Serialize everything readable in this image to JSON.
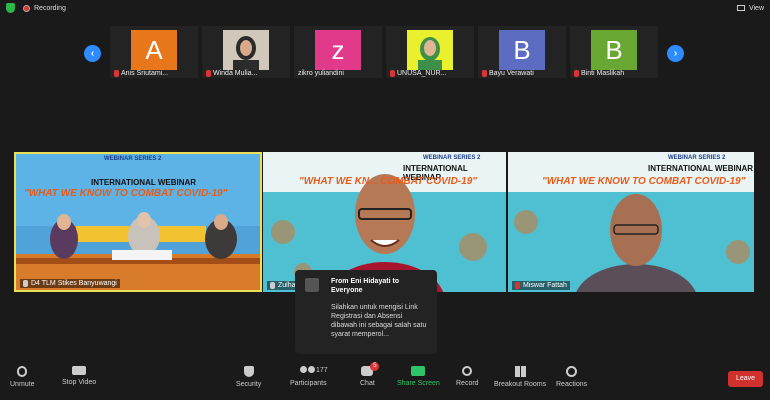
{
  "top": {
    "recording": "Recording",
    "view": "View"
  },
  "strip": {
    "participants": [
      {
        "initial": "A",
        "name": "Anis Sriutami...",
        "color": "#e8771c"
      },
      {
        "initial": "",
        "name": "Winda Mulia...",
        "color": "#c9c0b0"
      },
      {
        "initial": "z",
        "name": "zikro yuliandini",
        "color": "#e13a8b"
      },
      {
        "initial": "",
        "name": "UNUSA_NUR...",
        "color": "#e9f02d"
      },
      {
        "initial": "B",
        "name": "Bayu Verawati",
        "color": "#5b6cc1"
      },
      {
        "initial": "B",
        "name": "Binti Maslikah",
        "color": "#68a832"
      }
    ]
  },
  "videos": [
    {
      "name": "D4 TLM Stikes Banyuwangi",
      "series": "WEBINAR SERIES 2",
      "title": "INTERNATIONAL WEBINAR",
      "theme": "\"WHAT WE KNOW TO COMBAT COVID-19\""
    },
    {
      "name": "Zulha...",
      "series": "WEBINAR SERIES 2",
      "title": "INTERNATIONAL WEBINAR",
      "theme": "\"WHAT WE KN... COMBAT COVID-19\""
    },
    {
      "name": "Miswar Fattah",
      "series": "WEBINAR SERIES 2",
      "title": "INTERNATIONAL WEBINAR",
      "theme": "\"WHAT WE KNOW TO COMBAT COVID-19\""
    }
  ],
  "chat": {
    "from": "From Eni Hidayati to Everyone",
    "message": "Silahkan untuk mengisi Link Registrasi dan Absensi dibawah ini sebagai salah satu syarat memperol..."
  },
  "toolbar": {
    "unmute": "Unmute",
    "stop_video": "Stop Video",
    "security": "Security",
    "participants": "Participants",
    "participants_count": "177",
    "chat": "Chat",
    "chat_badge": "5",
    "share_screen": "Share Screen",
    "record": "Record",
    "breakout": "Breakout Rooms",
    "reactions": "Reactions",
    "leave": "Leave"
  }
}
